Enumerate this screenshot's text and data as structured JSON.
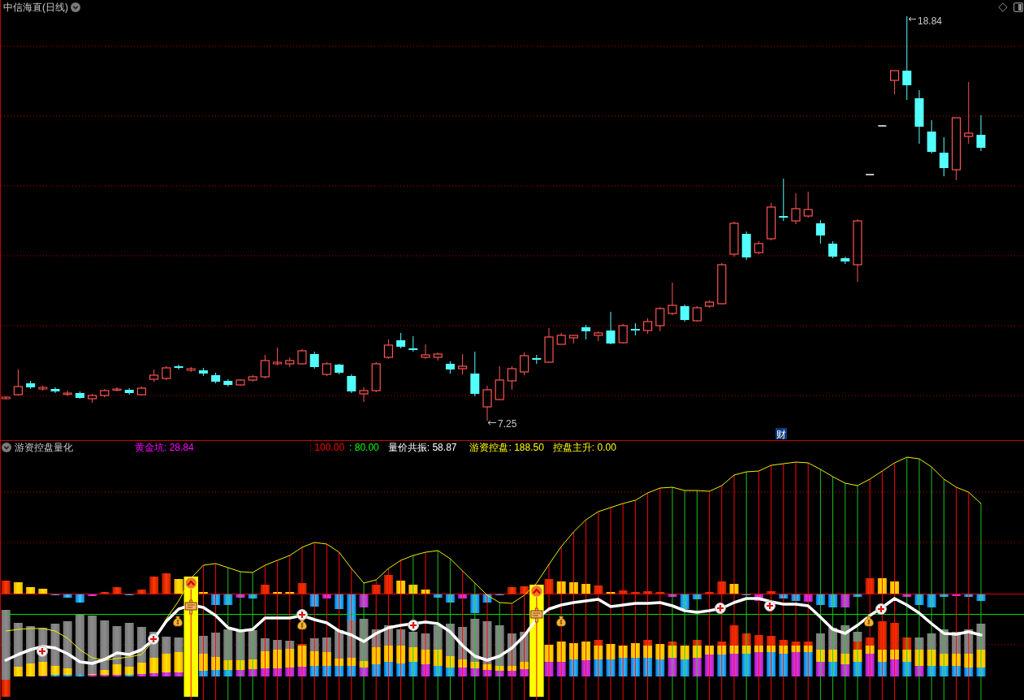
{
  "window": {
    "title": "中信海直(日线)"
  },
  "price_chart": {
    "high_label": "18.84",
    "low_label": "7.25",
    "badge": "财"
  },
  "indicator": {
    "name": "游资控盘量化",
    "readings": [
      {
        "text": "黄金坑: 28.84",
        "color": "#ff00ff"
      },
      {
        "text": ": 100.00",
        "color": "#ff0000"
      },
      {
        "text": ": 80.00",
        "color": "#00ff00"
      },
      {
        "text": "量价共振: 58.87",
        "color": "#ffffff"
      },
      {
        "text": "游资控盘: 188.50",
        "color": "#ffff00"
      },
      {
        "text": "控盘主升: 0.00",
        "color": "#ffff00"
      }
    ]
  }
}
